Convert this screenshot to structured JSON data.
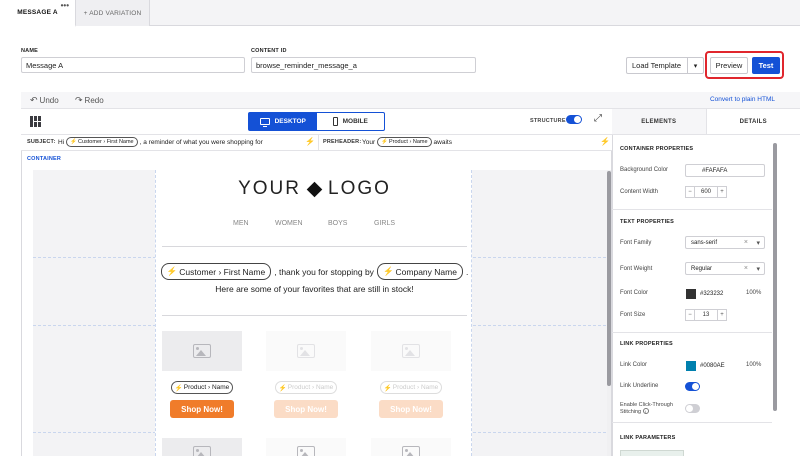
{
  "tabs": {
    "active": "MESSAGE A",
    "add": "+ ADD VARIATION",
    "menu_glyph": "•••"
  },
  "form": {
    "name_label": "NAME",
    "name_value": "Message A",
    "content_id_label": "CONTENT ID",
    "content_id_value": "browse_reminder_message_a"
  },
  "actions": {
    "load_template": "Load Template",
    "dropdown_glyph": "▾",
    "preview": "Preview",
    "test": "Test"
  },
  "editor": {
    "undo": "Undo",
    "redo": "Redo",
    "desktop": "DESKTOP",
    "mobile": "MOBILE",
    "structure": "STRUCTURE",
    "structure_on": true,
    "subject_label": "SUBJECT:",
    "subject_pre": "Hi",
    "subject_token": "Customer › First Name",
    "subject_post": ", a reminder of what you were shopping for",
    "preheader_label": "PREHEADER:",
    "preheader_pre": "Your",
    "preheader_token": "Product › Name",
    "preheader_post": "awaits",
    "container_label": "CONTAINER"
  },
  "email": {
    "logo_left": "YOUR",
    "logo_right": "LOGO",
    "nav": [
      "MEN",
      "WOMEN",
      "BOYS",
      "GIRLS"
    ],
    "greeting_token1": "Customer › First Name",
    "greeting_mid": ", thank you for stopping by",
    "greeting_token2": "Company Name",
    "greeting_end": ".",
    "subline": "Here are some of your favorites that are still in stock!",
    "product_token": "Product › Name",
    "shop_button": "Shop Now!"
  },
  "sidebar": {
    "convert_link": "Convert to plain HTML",
    "tab_elements": "ELEMENTS",
    "tab_details": "DETAILS",
    "container_props": {
      "title": "CONTAINER PROPERTIES",
      "bg_label": "Background Color",
      "bg_value": "#FAFAFA",
      "width_label": "Content Width",
      "width_value": "600"
    },
    "text_props": {
      "title": "TEXT PROPERTIES",
      "family_label": "Font Family",
      "family_value": "sans-serif",
      "weight_label": "Font Weight",
      "weight_value": "Regular",
      "color_label": "Font Color",
      "color_value": "#323232",
      "color_hex": "#323232",
      "color_pct": "100%",
      "size_label": "Font Size",
      "size_value": "13"
    },
    "link_props": {
      "title": "LINK PROPERTIES",
      "color_label": "Link Color",
      "color_value": "#0080AE",
      "color_hex": "#0080AE",
      "color_pct": "100%",
      "underline_label": "Link Underline",
      "underline_on": true,
      "clickthrough_label_1": "Enable Click-Through",
      "clickthrough_label_2": "Stitching",
      "clickthrough_on": false
    },
    "link_params": {
      "title": "LINK PARAMETERS"
    }
  },
  "colors": {
    "accent": "#1451D6",
    "highlight": "#E0262D",
    "shop_button": "#F07C2A"
  }
}
